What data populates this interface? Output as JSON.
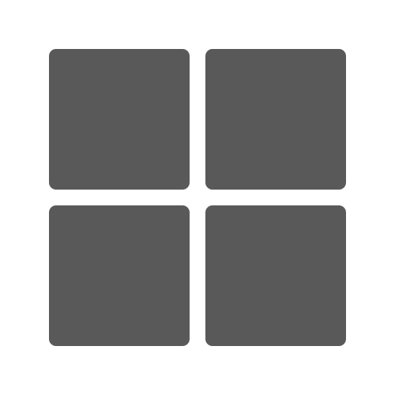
{
  "icon": {
    "name": "windows-grid-icon",
    "tile_color": "#595959",
    "background_color": "#ffffff"
  }
}
